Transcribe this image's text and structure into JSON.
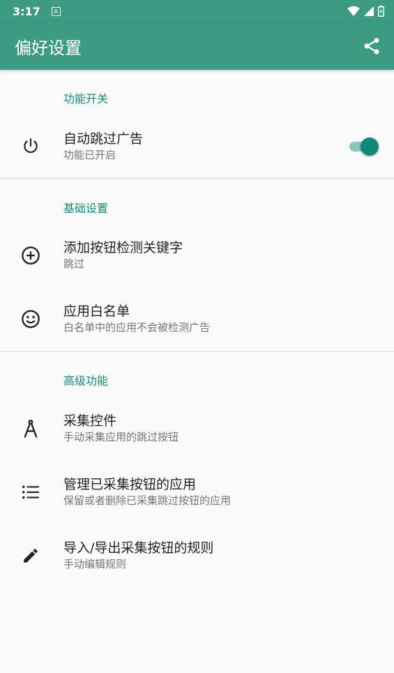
{
  "status_bar": {
    "time": "3:17",
    "notification_icon": "A"
  },
  "app_bar": {
    "title": "偏好设置",
    "action_icon": "share-icon"
  },
  "sections": [
    {
      "title": "功能开关",
      "items": [
        {
          "title": "自动跳过广告",
          "summary": "功能已开启",
          "icon": "power-icon",
          "toggle_on": true
        }
      ]
    },
    {
      "title": "基础设置",
      "items": [
        {
          "title": "添加按钮检测关键字",
          "summary": "跳过",
          "icon": "add-circle-icon"
        },
        {
          "title": "应用白名单",
          "summary": "白名单中的应用不会被检测广告",
          "icon": "smiley-icon"
        }
      ]
    },
    {
      "title": "高级功能",
      "items": [
        {
          "title": "采集控件",
          "summary": "手动采集应用的跳过按钮",
          "icon": "compass-icon"
        },
        {
          "title": "管理已采集按钮的应用",
          "summary": "保留或者删除已采集跳过按钮的应用",
          "icon": "list-icon"
        },
        {
          "title": "导入/导出采集按钮的规则",
          "summary": "手动编辑规则",
          "icon": "pencil-icon"
        }
      ]
    }
  ],
  "colors": {
    "primary": "#3e9a82",
    "accent": "#128a76",
    "toggle_thumb": "#11897a"
  }
}
